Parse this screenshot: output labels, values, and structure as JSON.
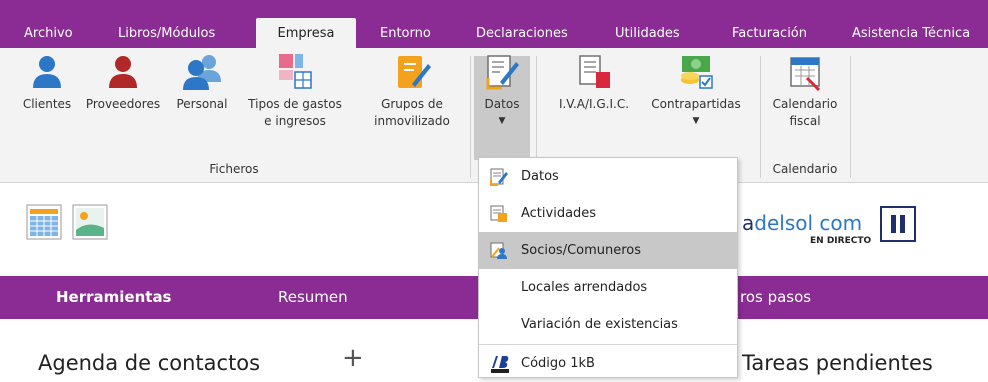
{
  "tabs": [
    {
      "label": "Archivo"
    },
    {
      "label": "Libros/Módulos"
    },
    {
      "label": "Empresa"
    },
    {
      "label": "Entorno"
    },
    {
      "label": "Declaraciones"
    },
    {
      "label": "Utilidades"
    },
    {
      "label": "Facturación"
    },
    {
      "label": "Asistencia Técnica"
    }
  ],
  "ribbon": {
    "ficheros": {
      "label": "Ficheros",
      "clientes": "Clientes",
      "proveedores": "Proveedores",
      "personal": "Personal",
      "tipos_l1": "Tipos de gastos",
      "tipos_l2": "e ingresos",
      "grupos_l1": "Grupos de",
      "grupos_l2": "inmovilizado"
    },
    "datos": "Datos",
    "iva": "I.V.A/I.G.I.C.",
    "contrapartidas": "Contrapartidas",
    "calendario": {
      "label": "Calendario",
      "btn_l1": "Calendario",
      "btn_l2": "fiscal"
    }
  },
  "menu": [
    {
      "label": "Datos"
    },
    {
      "label": "Actividades"
    },
    {
      "label": "Socios/Comuneros"
    },
    {
      "label": "Locales arrendados"
    },
    {
      "label": "Variación de existencias"
    },
    {
      "label": "Código 1kB"
    }
  ],
  "banner": {
    "brand1": "a",
    "brand2": "delsol",
    "brand3": " com",
    "sub": "EN DIRECTO"
  },
  "herramientas": "Herramientas",
  "resumen": "Resumen",
  "pasos": "ros pasos",
  "agenda": "Agenda de contactos",
  "plus": "+",
  "tareas": "Tareas pendientes",
  "colors": {
    "accent": "#8a2c93",
    "ribbon": "#f3f3f3",
    "highlight": "#c8c8c8"
  }
}
